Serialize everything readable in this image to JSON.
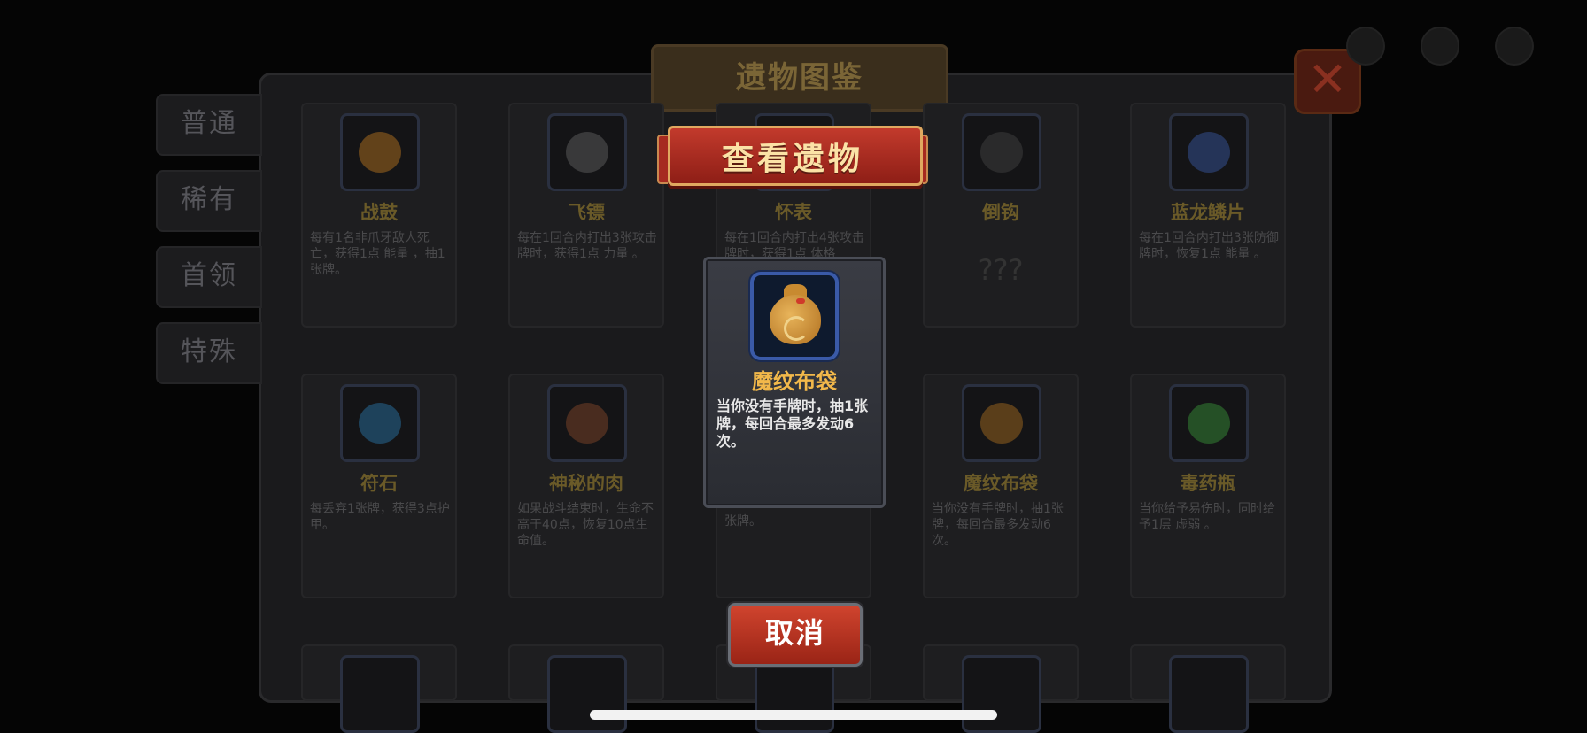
{
  "background": {
    "title": "遗物图鉴",
    "tabs": [
      "普通",
      "稀有",
      "首领",
      "特殊"
    ],
    "cards": [
      {
        "name": "战鼓",
        "desc": "每有1名非爪牙敌人死亡，获得1点 能量 ，抽1张牌。"
      },
      {
        "name": "飞镖",
        "desc": "每在1回合内打出3张攻击牌时，获得1点 力量 。"
      },
      {
        "name": "怀表",
        "desc": "每在1回合内打出4张攻击牌时，获得1点 体格"
      },
      {
        "name": "倒钩",
        "desc": "???"
      },
      {
        "name": "蓝龙鳞片",
        "desc": "每在1回合内打出3张防御牌时，恢复1点 能量 。"
      },
      {
        "name": "符石",
        "desc": "每丢弃1张牌，获得3点护甲。"
      },
      {
        "name": "神秘的肉",
        "desc": "如果战斗结束时，生命不高于40点，恢复10点生命值。"
      },
      {
        "name": "",
        "desc": "张牌。"
      },
      {
        "name": "魔纹布袋",
        "desc": "当你没有手牌时，抽1张牌，每回合最多发动6次。"
      },
      {
        "name": "毒药瓶",
        "desc": "当你给予易伤时，同时给予1层 虚弱 。"
      }
    ]
  },
  "dialog": {
    "banner": "查看遗物",
    "relic": {
      "icon": "cloth-pouch-icon",
      "name": "魔纹布袋",
      "desc": "当你没有手牌时，抽1张牌，每回合最多发动6次。"
    },
    "cancel_label": "取消"
  },
  "colors": {
    "banner_red": "#b02c20",
    "relic_name": "#f2b84a",
    "cancel_red": "#c03a26"
  }
}
